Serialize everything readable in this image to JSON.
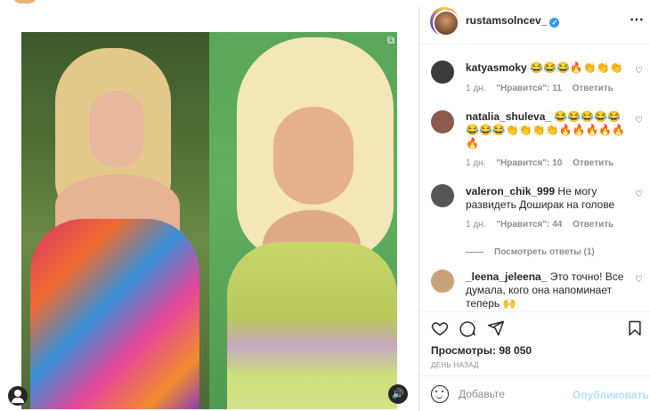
{
  "post": {
    "author": "rustamsolncev_",
    "verified": true
  },
  "comments": [
    {
      "user": "katyasmoky",
      "text": "😂😂😂🔥👏👏👏",
      "time": "1 дн.",
      "likes": "\"Нравится\": 11",
      "reply": "Ответить",
      "avatar_color": "#3b3b3b"
    },
    {
      "user": "natalia_shuleva_",
      "text": "😂😂😂😂😂😂😂😂👏👏👏👏🔥🔥🔥🔥🔥🔥",
      "time": "1 дн.",
      "likes": "\"Нравится\": 10",
      "reply": "Ответить",
      "avatar_color": "#8a5a4a"
    },
    {
      "user": "valeron_chik_999",
      "text": "Не могу развидеть Доширак на голове",
      "time": "1 дн.",
      "likes": "\"Нравится\": 44",
      "reply": "Ответить",
      "avatar_color": "#555555"
    },
    {
      "user": "_leena_jeleena_",
      "text": "Это точно! Все думала, кого она напоминает теперь 🙌",
      "avatar_color": "#c9a27a"
    }
  ],
  "view_replies": "Посмотреть ответы (1)",
  "views_label": "Просмотры: 98 050",
  "date": "ДЕНЬ НАЗАД",
  "add_comment": {
    "placeholder": "Добавьте",
    "publish": "Опубликовать"
  },
  "icons": {
    "more": "more-options-icon",
    "heart": "heart-icon",
    "comment": "comment-icon",
    "share": "share-icon",
    "save": "bookmark-icon",
    "emoji": "emoji-icon",
    "user": "user-tag-icon",
    "sound": "sound-icon"
  },
  "colors": {
    "verified": "#3897f0",
    "publish_disabled": "#b2dffc",
    "meta_text": "#8e8e8e"
  }
}
